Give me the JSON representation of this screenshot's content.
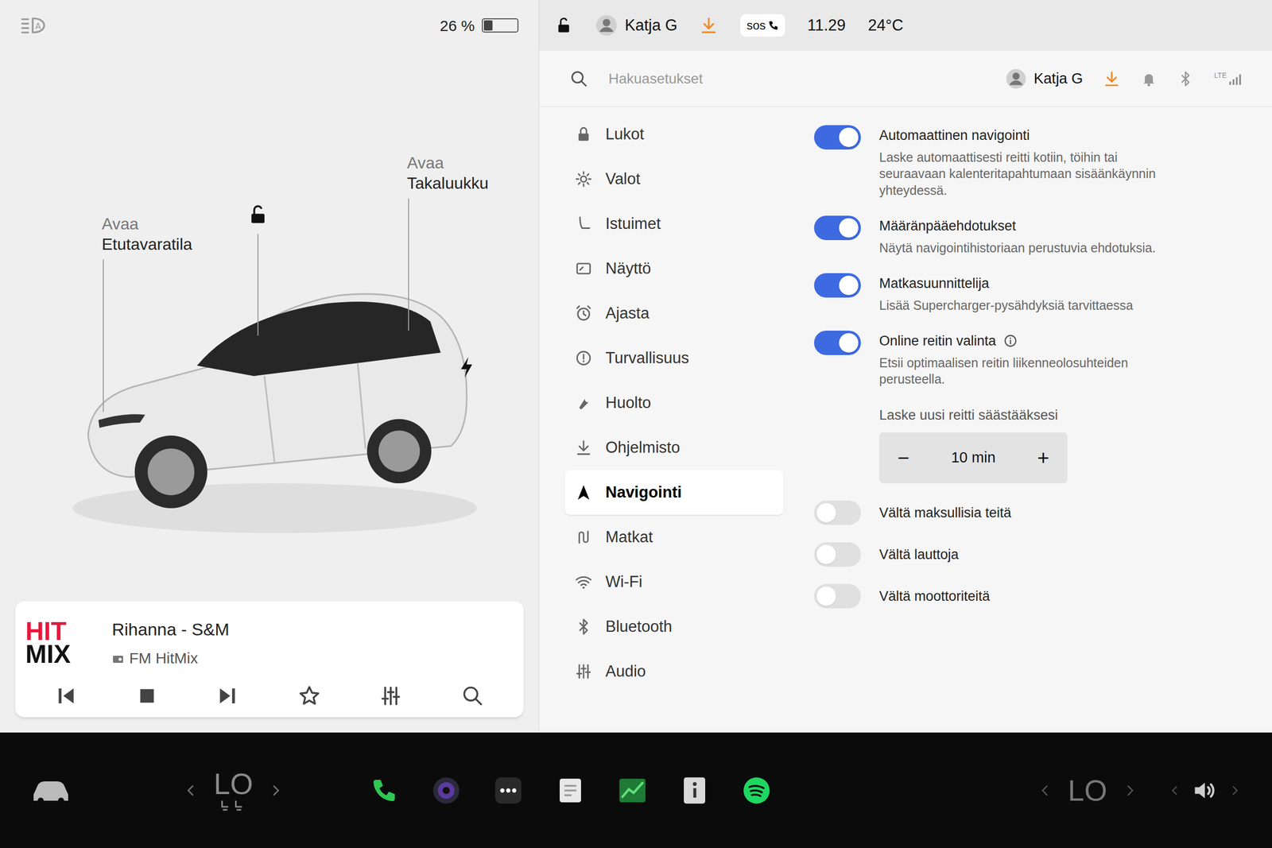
{
  "status_bar": {
    "battery": {
      "reading": "26 %",
      "level": 0.26
    },
    "locked": false,
    "user": "Katja G",
    "sos": "sos",
    "time": "11.29",
    "temperature": "24°C"
  },
  "car": {
    "frunk": {
      "action": "Avaa",
      "label": "Etutavaratila"
    },
    "trunk": {
      "action": "Avaa",
      "label": "Takaluukku"
    },
    "locked": false
  },
  "media": {
    "logo_top": "HIT",
    "logo_bottom": "MIX",
    "title": "Rihanna - S&M",
    "source": "FM HitMix"
  },
  "settings_header": {
    "search_placeholder": "Hakuasetukset",
    "user": "Katja G",
    "network": "LTE"
  },
  "menu": [
    {
      "label": "Lukot",
      "selected": false
    },
    {
      "label": "Valot",
      "selected": false
    },
    {
      "label": "Istuimet",
      "selected": false
    },
    {
      "label": "Näyttö",
      "selected": false
    },
    {
      "label": "Ajasta",
      "selected": false
    },
    {
      "label": "Turvallisuus",
      "selected": false
    },
    {
      "label": "Huolto",
      "selected": false
    },
    {
      "label": "Ohjelmisto",
      "selected": false
    },
    {
      "label": "Navigointi",
      "selected": true
    },
    {
      "label": "Matkat",
      "selected": false
    },
    {
      "label": "Wi-Fi",
      "selected": false
    },
    {
      "label": "Bluetooth",
      "selected": false
    },
    {
      "label": "Audio",
      "selected": false
    }
  ],
  "settings": [
    {
      "kind": "toggle",
      "title": "Automaattinen navigointi",
      "description": "Laske automaattisesti reitti kotiin, töihin tai seuraavaan kalenteritapahtumaan sisäänkäynnin yhteydessä.",
      "on": true,
      "info": false
    },
    {
      "kind": "toggle",
      "title": "Määränpääehdotukset",
      "description": "Näytä navigointihistoriaan perustuvia ehdotuksia.",
      "on": true,
      "info": false
    },
    {
      "kind": "toggle",
      "title": "Matkasuunnittelija",
      "description": "Lisää Supercharger-pysähdyksiä tarvittaessa",
      "on": true,
      "info": false
    },
    {
      "kind": "toggle",
      "title": "Online reitin valinta",
      "description": "Etsii optimaalisen reitin liikenneolosuhteiden perusteella.",
      "on": true,
      "info": true
    },
    {
      "kind": "stepper",
      "label": "Laske uusi reitti säästääksesi",
      "minus": "−",
      "value": "10 min",
      "plus": "+"
    },
    {
      "kind": "toggle",
      "title": "Vältä maksullisia teitä",
      "on": false,
      "info": false
    },
    {
      "kind": "toggle",
      "title": "Vältä lauttoja",
      "on": false,
      "info": false
    },
    {
      "kind": "toggle",
      "title": "Vältä moottoriteitä",
      "on": false,
      "info": false
    }
  ],
  "taskbar": {
    "climate_left": "LO",
    "climate_right": "LO"
  }
}
